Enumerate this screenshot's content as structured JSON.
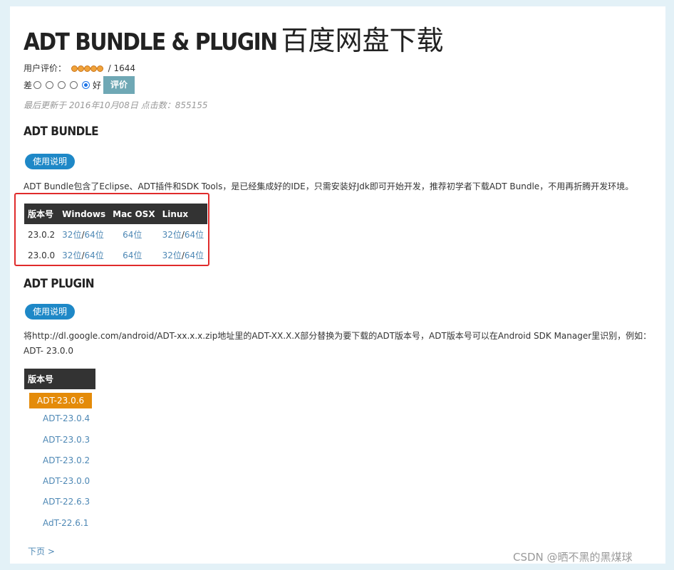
{
  "page": {
    "title_en": "ADT BUNDLE & PLUGIN",
    "title_zh": "百度网盘下载"
  },
  "rating": {
    "label": "用户评价：",
    "star_count": 5,
    "count_text": "/ 1644",
    "low_label": "差",
    "high_label": "好",
    "option_count": 5,
    "selected_option": 5,
    "submit_label": "评价"
  },
  "updated": "最后更新于 2016年10月08日 点击数：855155",
  "bundle": {
    "heading": "ADT BUNDLE",
    "help_button": "使用说明",
    "description": "ADT Bundle包含了Eclipse、ADT插件和SDK Tools，是已经集成好的IDE，只需安装好Jdk即可开始开发，推荐初学者下载ADT Bundle，不用再折腾开发环境。",
    "table": {
      "headers": [
        "版本号",
        "Windows",
        "Mac OSX",
        "Linux"
      ],
      "rows": [
        {
          "version": "23.0.2",
          "win32": "32位",
          "win64": "64位",
          "mac": "64位",
          "lin32": "32位",
          "lin64": "64位"
        },
        {
          "version": "23.0.0",
          "win32": "32位",
          "win64": "64位",
          "mac": "64位",
          "lin32": "32位",
          "lin64": "64位"
        }
      ]
    },
    "highlight_color": "#e02b2b"
  },
  "plugin": {
    "heading": "ADT PLUGIN",
    "help_button": "使用说明",
    "description_line1": "将http://dl.google.com/android/ADT-xx.x.x.zip地址里的ADT-XX.X.X部分替换为要下载的ADT版本号，ADT版本号可以在Android SDK Manager里识别，例如：",
    "description_line2": "ADT- 23.0.0",
    "list_header": "版本号",
    "versions": [
      "ADT-23.0.6",
      "ADT-23.0.4",
      "ADT-23.0.3",
      "ADT-23.0.2",
      "ADT-23.0.0",
      "ADT-22.6.3",
      "AdT-22.6.1"
    ],
    "next_label": "下页 >"
  },
  "watermark": "CSDN @晒不黑的黑煤球",
  "colors": {
    "background": "#e3f1f7",
    "header_bg": "#333333",
    "link": "#4e88b5",
    "pill": "#1e88c7",
    "selected_version": "#e48b09",
    "rate_button": "#6fa8b5"
  }
}
